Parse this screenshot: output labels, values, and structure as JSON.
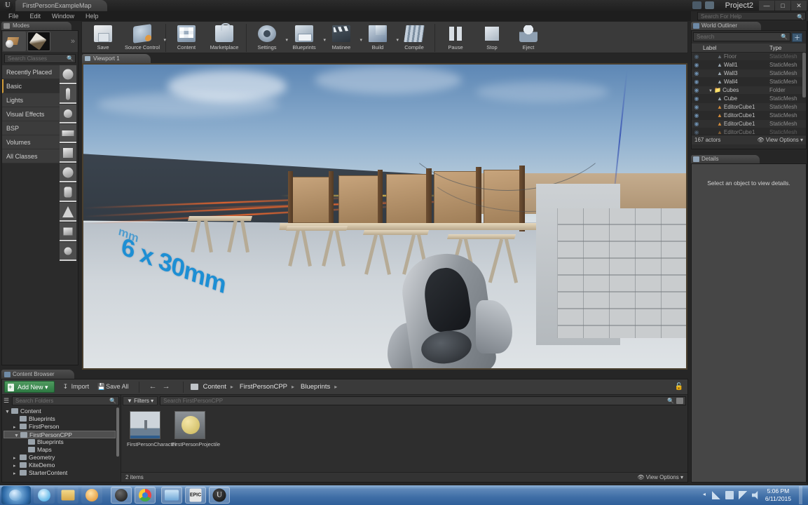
{
  "window": {
    "map_tab": "FirstPersonExampleMap",
    "project_title": "Project2",
    "minimize": "—",
    "maximize": "□",
    "close": "✕",
    "logo": "U"
  },
  "menu": {
    "items": [
      "File",
      "Edit",
      "Window",
      "Help"
    ],
    "help_search_placeholder": "Search For Help"
  },
  "modes": {
    "tab_label": "Modes",
    "search_placeholder": "Search Classes",
    "more": "»",
    "categories": [
      {
        "label": "Recently Placed",
        "active": false
      },
      {
        "label": "Basic",
        "active": true
      },
      {
        "label": "Lights",
        "active": false
      },
      {
        "label": "Visual Effects",
        "active": false
      },
      {
        "label": "BSP",
        "active": false
      },
      {
        "label": "Volumes",
        "active": false
      },
      {
        "label": "All Classes",
        "active": false
      }
    ],
    "place_items": [
      "sphere-actor",
      "character-actor",
      "point-light-actor",
      "plane-actor",
      "cube-actor",
      "sphere-mesh",
      "cylinder-mesh",
      "cone-mesh",
      "box-mesh",
      "sphere-on-box-mesh"
    ]
  },
  "toolbar": {
    "buttons": [
      {
        "label": "Save",
        "icon": "save-icon",
        "dropdown": false
      },
      {
        "label": "Source Control",
        "icon": "source-control-icon",
        "dropdown": true
      },
      {
        "label": "Content",
        "icon": "content-icon",
        "dropdown": false
      },
      {
        "label": "Marketplace",
        "icon": "marketplace-icon",
        "dropdown": false
      },
      {
        "label": "Settings",
        "icon": "settings-icon",
        "dropdown": true
      },
      {
        "label": "Blueprints",
        "icon": "blueprints-icon",
        "dropdown": true
      },
      {
        "label": "Matinee",
        "icon": "matinee-icon",
        "dropdown": true
      },
      {
        "label": "Build",
        "icon": "build-icon",
        "dropdown": true
      },
      {
        "label": "Compile",
        "icon": "compile-icon",
        "dropdown": false
      },
      {
        "label": "Pause",
        "icon": "pause-icon",
        "dropdown": false
      },
      {
        "label": "Stop",
        "icon": "stop-icon",
        "dropdown": false
      },
      {
        "label": "Eject",
        "icon": "eject-icon",
        "dropdown": false
      }
    ]
  },
  "viewport": {
    "tab_label": "Viewport 1",
    "scene_text": "6 x 30mm",
    "scene_text_small": "mm"
  },
  "world_outliner": {
    "tab_label": "World Outliner",
    "search_placeholder": "Search",
    "add_button": "＋",
    "columns": {
      "label": "Label",
      "type": "Type"
    },
    "rows": [
      {
        "label": "Floor",
        "type": "StaticMesh",
        "icon": "mesh-icon",
        "indent": 1
      },
      {
        "label": "Wall1",
        "type": "StaticMesh",
        "icon": "mesh-icon",
        "indent": 1
      },
      {
        "label": "Wall3",
        "type": "StaticMesh",
        "icon": "mesh-icon",
        "indent": 1
      },
      {
        "label": "Wall4",
        "type": "StaticMesh",
        "icon": "mesh-icon",
        "indent": 1
      },
      {
        "label": "Cubes",
        "type": "Folder",
        "icon": "folder-icon",
        "indent": 0
      },
      {
        "label": "Cube",
        "type": "StaticMesh",
        "icon": "mesh-icon",
        "indent": 1
      },
      {
        "label": "EditorCube1",
        "type": "StaticMesh",
        "icon": "cube-icon",
        "indent": 1
      },
      {
        "label": "EditorCube1",
        "type": "StaticMesh",
        "icon": "cube-icon",
        "indent": 1
      },
      {
        "label": "EditorCube1",
        "type": "StaticMesh",
        "icon": "cube-icon",
        "indent": 1
      },
      {
        "label": "EditorCube1",
        "type": "StaticMesh",
        "icon": "cube-icon",
        "indent": 1
      }
    ],
    "actor_count": "167 actors",
    "view_options": "View Options"
  },
  "details": {
    "tab_label": "Details",
    "empty_message": "Select an object to view details."
  },
  "content_browser": {
    "tab_label": "Content Browser",
    "add_new": "Add New",
    "import": "Import",
    "save_all": "Save All",
    "breadcrumb": [
      "Content",
      "FirstPersonCPP",
      "Blueprints"
    ],
    "folder_search_placeholder": "Search Folders",
    "filters_label": "Filters",
    "asset_search_placeholder": "Search FirstPersonCPP",
    "tree": [
      {
        "label": "Content",
        "indent": 0,
        "expand": "▼",
        "selected": false
      },
      {
        "label": "Blueprints",
        "indent": 1,
        "expand": "",
        "selected": false
      },
      {
        "label": "FirstPerson",
        "indent": 1,
        "expand": "▸",
        "selected": false
      },
      {
        "label": "FirstPersonCPP",
        "indent": 1,
        "expand": "▼",
        "selected": true
      },
      {
        "label": "Blueprints",
        "indent": 2,
        "expand": "",
        "selected": false
      },
      {
        "label": "Maps",
        "indent": 2,
        "expand": "",
        "selected": false
      },
      {
        "label": "Geometry",
        "indent": 1,
        "expand": "▸",
        "selected": false
      },
      {
        "label": "KiteDemo",
        "indent": 1,
        "expand": "▸",
        "selected": false
      },
      {
        "label": "StarterContent",
        "indent": 1,
        "expand": "▸",
        "selected": false
      }
    ],
    "assets": [
      {
        "name": "FirstPersonCharacter",
        "thumb": "blueprint-character-thumb"
      },
      {
        "name": "FirstPersonProjectile",
        "thumb": "blueprint-projectile-thumb"
      }
    ],
    "item_count": "2 items",
    "view_options": "View Options"
  },
  "taskbar": {
    "start": "start-orb-icon",
    "apps": [
      {
        "name": "internet-explorer-icon",
        "boxed": false
      },
      {
        "name": "file-explorer-icon",
        "boxed": false
      },
      {
        "name": "media-player-icon",
        "boxed": false
      },
      {
        "name": "obs-icon",
        "boxed": true
      },
      {
        "name": "chrome-icon",
        "boxed": true
      },
      {
        "name": "image-viewer-icon",
        "boxed": true
      },
      {
        "name": "epic-launcher-icon",
        "boxed": true
      },
      {
        "name": "unreal-editor-icon",
        "boxed": true
      }
    ],
    "time": "5:06 PM",
    "date": "6/11/2015"
  }
}
